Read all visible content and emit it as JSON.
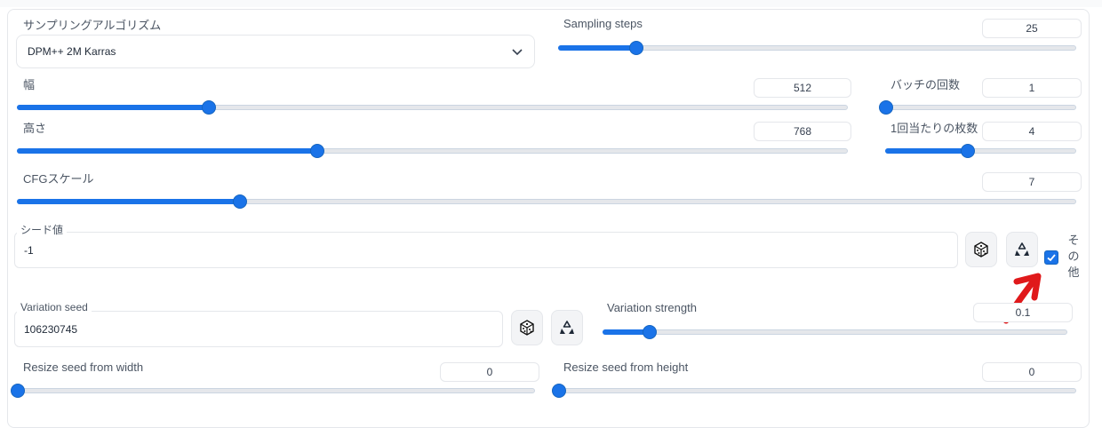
{
  "sampling": {
    "label": "サンプリングアルゴリズム",
    "value": "DPM++ 2M Karras",
    "icon": "chevron-down-icon"
  },
  "steps": {
    "label": "Sampling steps",
    "value": "25",
    "level": 0.15
  },
  "width": {
    "label": "幅",
    "value": "512",
    "level": 0.23
  },
  "batch_count": {
    "label": "バッチの回数",
    "value": "1",
    "level": 0.0
  },
  "height": {
    "label": "高さ",
    "value": "768",
    "level": 0.36
  },
  "batch_size": {
    "label": "1回当たりの枚数",
    "value": "4",
    "level": 0.43
  },
  "cfg": {
    "label": "CFGスケール",
    "value": "7",
    "level": 0.21
  },
  "seed": {
    "label": "シード値",
    "value": "-1",
    "dice_icon": "dice-icon",
    "recycle_icon": "recycle-icon"
  },
  "extra": {
    "label_chars": [
      "そ",
      "の",
      "他"
    ],
    "checked": true
  },
  "variation_seed": {
    "label": "Variation seed",
    "value": "106230745"
  },
  "variation_strength": {
    "label": "Variation strength",
    "value": "0.1",
    "level": 0.1
  },
  "resize_width": {
    "label": "Resize seed from width",
    "value": "0",
    "level": 0.0
  },
  "resize_height": {
    "label": "Resize seed from height",
    "value": "0",
    "level": 0.0
  },
  "colors": {
    "accent": "#1a73e8",
    "annotation": "#e0191b"
  }
}
